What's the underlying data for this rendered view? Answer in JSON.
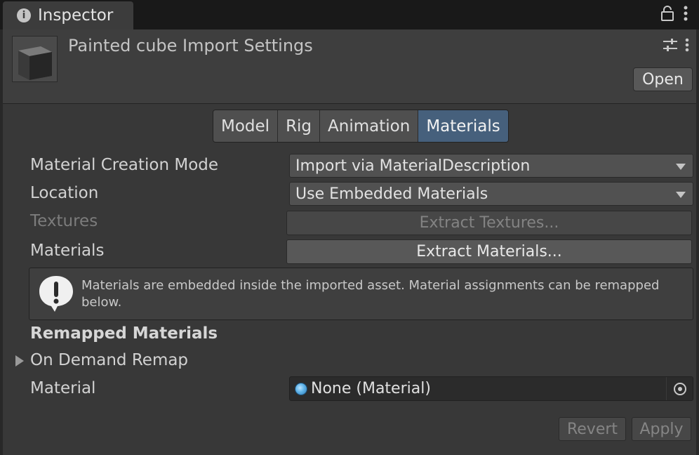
{
  "window": {
    "tab_title": "Inspector",
    "tab_icon": "info-icon"
  },
  "header": {
    "title": "Painted cube Import Settings",
    "open_label": "Open"
  },
  "tabs": [
    {
      "label": "Model",
      "active": false
    },
    {
      "label": "Rig",
      "active": false
    },
    {
      "label": "Animation",
      "active": false
    },
    {
      "label": "Materials",
      "active": true
    }
  ],
  "fields": {
    "material_creation_mode": {
      "label": "Material Creation Mode",
      "value": "Import via MaterialDescription"
    },
    "location": {
      "label": "Location",
      "value": "Use Embedded Materials"
    },
    "textures": {
      "label": "Textures",
      "button": "Extract Textures...",
      "enabled": false
    },
    "materials": {
      "label": "Materials",
      "button": "Extract Materials..."
    }
  },
  "help_box": {
    "icon": "warning-exclamation-icon",
    "text": "Materials are embedded inside the imported asset. Material assignments can be remapped below."
  },
  "remapped": {
    "title": "Remapped Materials",
    "foldout_label": "On Demand Remap",
    "foldout_expanded": false,
    "material_label": "Material",
    "material_value": "None (Material)"
  },
  "footer": {
    "revert": "Revert",
    "apply": "Apply",
    "enabled": false
  },
  "colors": {
    "active_tab": "#46607c",
    "background": "#383838"
  }
}
